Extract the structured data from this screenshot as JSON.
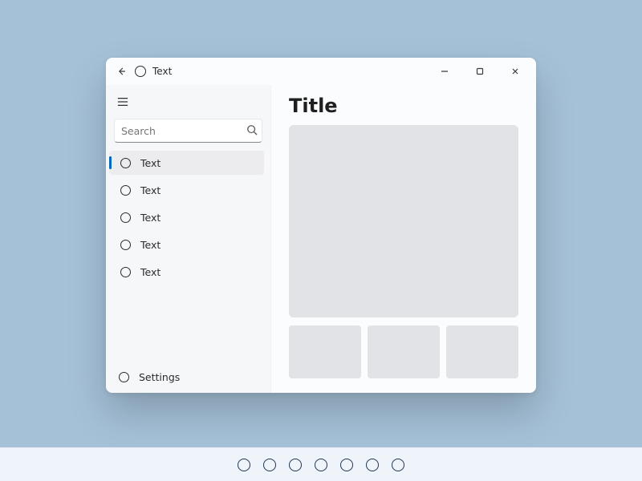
{
  "window": {
    "title": "Text"
  },
  "nav": {
    "search_placeholder": "Search",
    "items": [
      {
        "label": "Text",
        "selected": true
      },
      {
        "label": "Text",
        "selected": false
      },
      {
        "label": "Text",
        "selected": false
      },
      {
        "label": "Text",
        "selected": false
      },
      {
        "label": "Text",
        "selected": false
      }
    ],
    "settings_label": "Settings"
  },
  "content": {
    "title": "Title"
  },
  "taskbar": {
    "pins": 7
  },
  "colors": {
    "desktop_bg": "#a5c1d8",
    "accent": "#0067c0",
    "placeholder_block": "#e2e3e6"
  }
}
